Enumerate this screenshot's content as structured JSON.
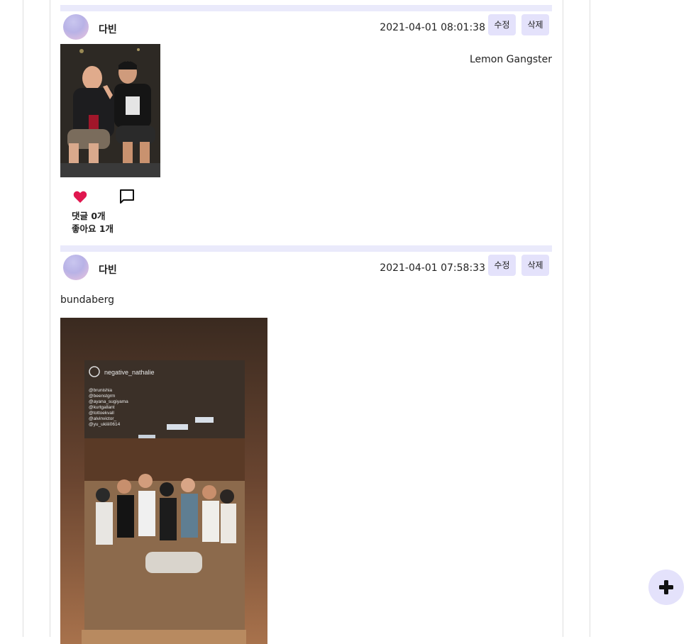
{
  "posts": [
    {
      "author": "다빈",
      "timestamp": "2021-04-01 08:01:38",
      "edit_label": "수정",
      "delete_label": "삭제",
      "caption": "Lemon Gangster",
      "comments_label": "댓글 0개",
      "likes_label": "좋아요 1개",
      "liked": true
    },
    {
      "author": "다빈",
      "timestamp": "2021-04-01 07:58:33",
      "edit_label": "수정",
      "delete_label": "삭제",
      "caption": "bundaberg",
      "photo_overlay": {
        "username": "negative_nathalie",
        "tags": [
          "@brunishia",
          "@beenstgrm",
          "@ayana_sugiyama",
          "@kurtgallant",
          "@tottoekvall",
          "@alvinvictor_",
          "@yu_ukiiii0614"
        ]
      }
    }
  ],
  "fab": {
    "icon": "plus-icon"
  },
  "colors": {
    "accent": "#e4e2fb",
    "bar": "#eaeafb",
    "heart": "#e0174f"
  }
}
